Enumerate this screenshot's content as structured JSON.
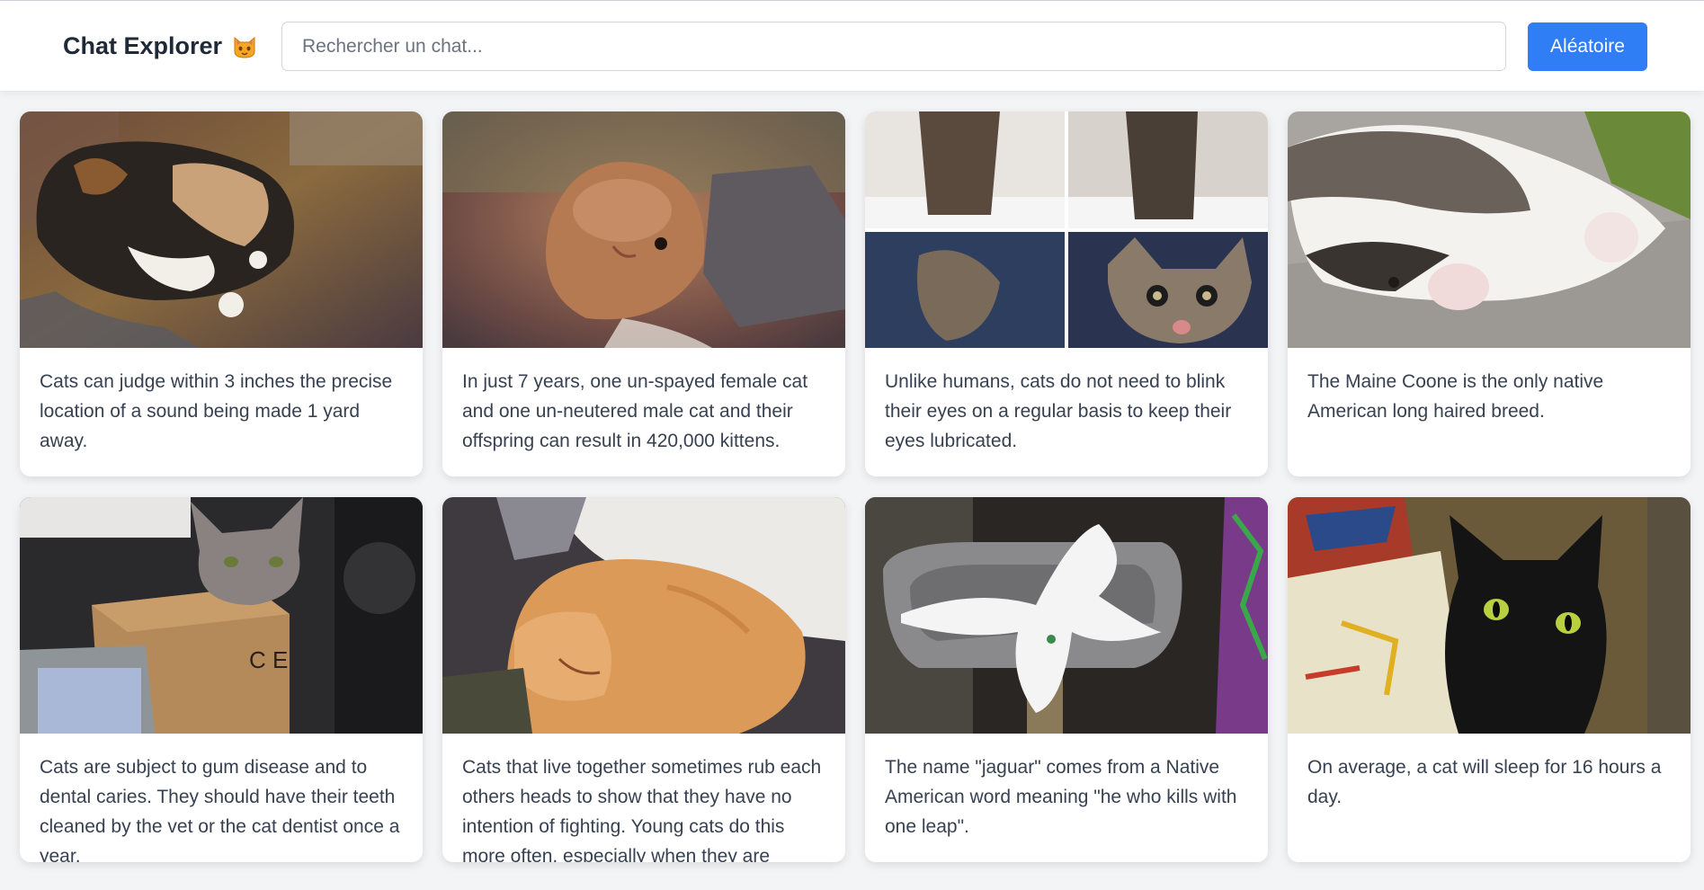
{
  "app": {
    "title": "Chat Explorer",
    "logo_icon": "cat-face-icon"
  },
  "search": {
    "value": "",
    "placeholder": "Rechercher un chat..."
  },
  "random_button": {
    "label": "Aléatoire"
  },
  "colors": {
    "accent": "#2f7ef5",
    "page_background": "#f3f4f6",
    "card_background": "#ffffff",
    "text": "#374151"
  },
  "cards": [
    {
      "image_alt": "calico cat lying on a patterned blanket",
      "fact": "Cats can judge within 3 inches the precise location of a sound being made 1 yard away."
    },
    {
      "image_alt": "orange kitten lying on its back",
      "fact": "In just 7 years, one un-spayed female cat and one un-neutered male cat and their offspring can result in 420,000 kittens."
    },
    {
      "image_alt": "four-panel collage of a tabby kitten",
      "fact": "Unlike humans, cats do not need to blink their eyes on a regular basis to keep their eyes lubricated."
    },
    {
      "image_alt": "tabby and white cat stretching on pavement",
      "fact": "The Maine Coone is the only native American long haired breed."
    },
    {
      "image_alt": "grey tabby cat resting on a cardboard box",
      "fact": "Cats are subject to gum disease and to dental caries. They should have their teeth cleaned by the vet or the cat dentist once a year."
    },
    {
      "image_alt": "orange cat sleeping curled up",
      "fact": "Cats that live together sometimes rub each others heads to show that they have no intention of fighting. Young cats do this more often, especially when they are excited."
    },
    {
      "image_alt": "white fluffy cat sprawled on a cat bed",
      "fact": "The name \"jaguar\" comes from a Native American word meaning \"he who kills with one leap\"."
    },
    {
      "image_alt": "black cat with green eyes",
      "fact": "On average, a cat will sleep for 16 hours a day."
    }
  ]
}
